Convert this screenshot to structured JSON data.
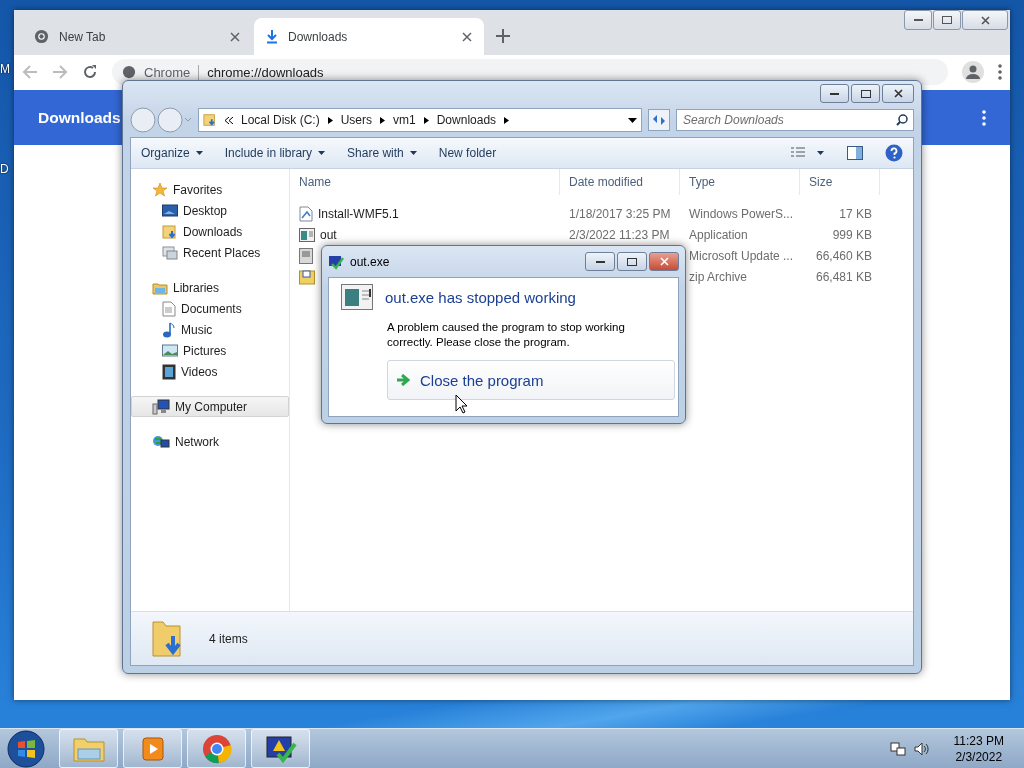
{
  "desktop": {
    "edge_labels": [
      "M",
      "D"
    ]
  },
  "chrome": {
    "tabs": [
      {
        "label": "New Tab",
        "selected": false
      },
      {
        "label": "Downloads",
        "selected": true
      }
    ],
    "omnibox": {
      "site": "Chrome",
      "url": "chrome://downloads"
    },
    "page_title": "Downloads"
  },
  "explorer": {
    "breadcrumbs": [
      "Local Disk (C:)",
      "Users",
      "vm1",
      "Downloads"
    ],
    "search": {
      "placeholder": "Search Downloads"
    },
    "toolbar": [
      {
        "label": "Organize",
        "dropdown": true
      },
      {
        "label": "Include in library",
        "dropdown": true
      },
      {
        "label": "Share with",
        "dropdown": true
      },
      {
        "label": "New folder",
        "dropdown": false
      }
    ],
    "nav": [
      {
        "label": "Favorites",
        "kind": "star",
        "selected": false,
        "children": [
          {
            "label": "Desktop",
            "kind": "desktop",
            "selected": false
          },
          {
            "label": "Downloads",
            "kind": "downloads",
            "selected": false
          },
          {
            "label": "Recent Places",
            "kind": "recent",
            "selected": false
          }
        ]
      },
      {
        "label": "Libraries",
        "kind": "library",
        "selected": false,
        "children": [
          {
            "label": "Documents",
            "kind": "document",
            "selected": false
          },
          {
            "label": "Music",
            "kind": "music",
            "selected": false
          },
          {
            "label": "Pictures",
            "kind": "picture",
            "selected": false
          },
          {
            "label": "Videos",
            "kind": "video",
            "selected": false
          }
        ]
      },
      {
        "label": "My Computer",
        "kind": "computer",
        "selected": true
      },
      {
        "label": "Network",
        "kind": "network",
        "selected": false
      }
    ],
    "columns": [
      "Name",
      "Date modified",
      "Type",
      "Size"
    ],
    "rows": [
      {
        "kind": "script",
        "name": "Install-WMF5.1",
        "date": "1/18/2017 3:25 PM",
        "type": "Windows PowerS...",
        "size": "17 KB"
      },
      {
        "kind": "app",
        "name": "out",
        "date": "2/3/2022 11:23 PM",
        "type": "Application",
        "size": "999 KB"
      },
      {
        "kind": "update",
        "type": "Microsoft Update ...",
        "size": "66,460 KB"
      },
      {
        "kind": "zip",
        "type": "zip Archive",
        "size": "66,481 KB"
      }
    ],
    "status": "4 items"
  },
  "dialog": {
    "title": "out.exe",
    "heading": "out.exe has stopped working",
    "message": "A problem caused the program to stop working correctly. Please close the program.",
    "action": "Close the program"
  },
  "taskbar": {
    "apps": [
      {
        "kind": "explorer"
      },
      {
        "kind": "media"
      },
      {
        "kind": "chrome"
      },
      {
        "kind": "action-center"
      }
    ],
    "time": "11:23 PM",
    "date": "2/3/2022"
  }
}
